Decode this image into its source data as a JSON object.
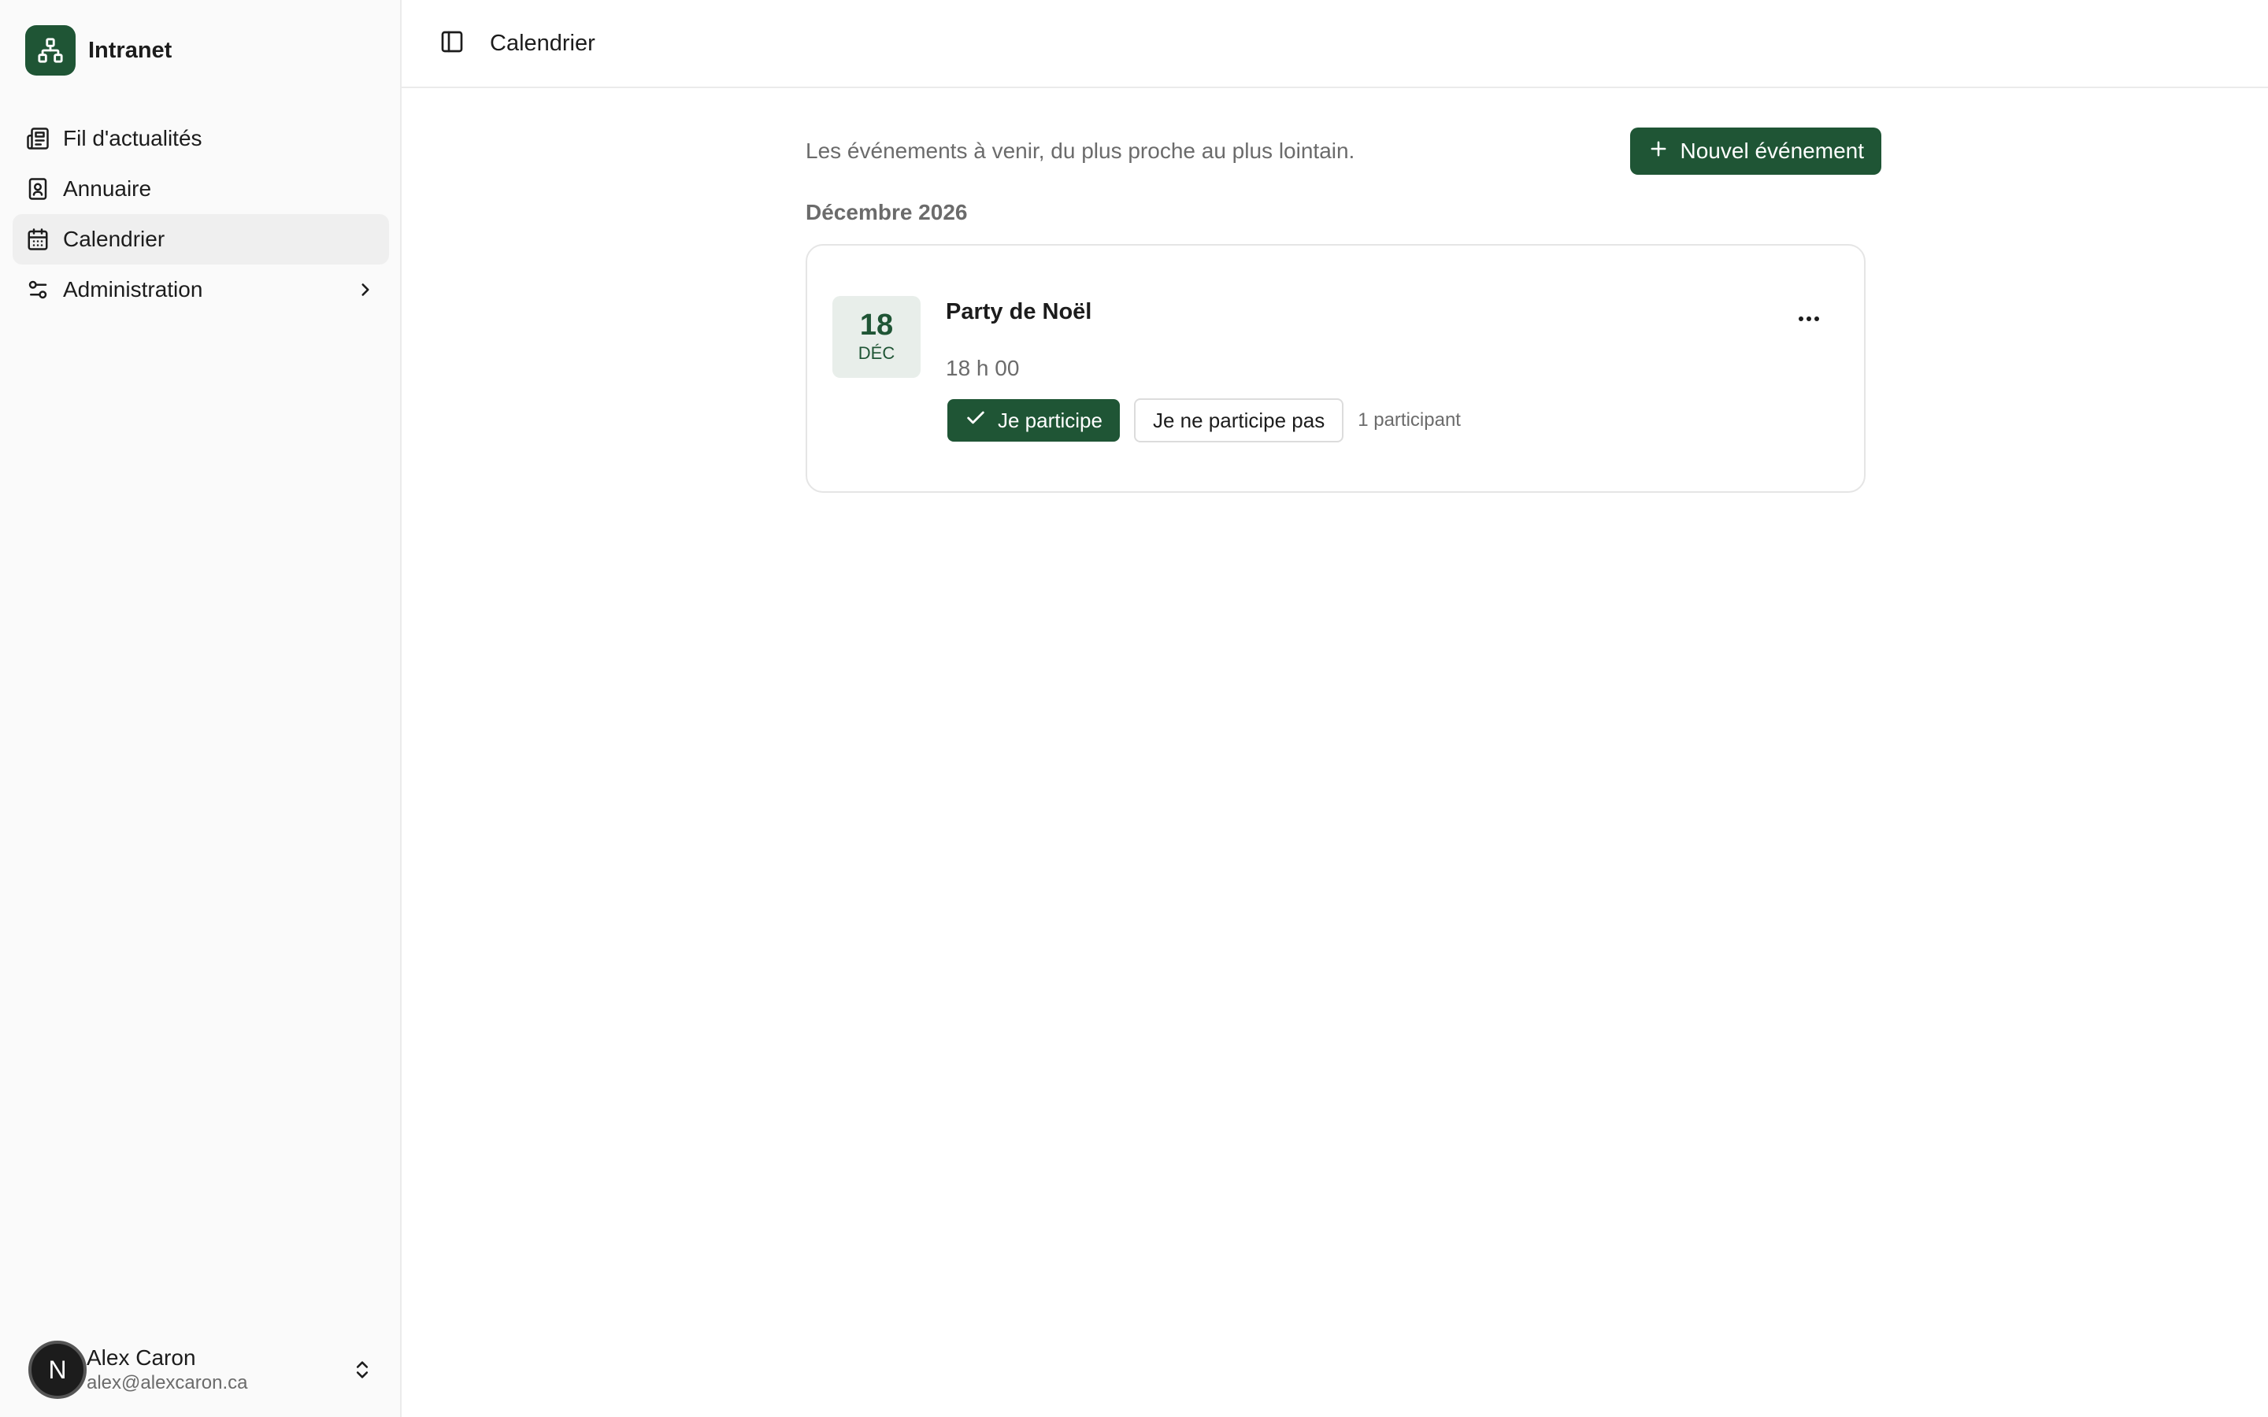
{
  "app": {
    "name": "Intranet"
  },
  "sidebar": {
    "items": [
      {
        "label": "Fil d'actualités",
        "icon": "newspaper-icon",
        "active": false
      },
      {
        "label": "Annuaire",
        "icon": "contact-book-icon",
        "active": false
      },
      {
        "label": "Calendrier",
        "icon": "calendar-icon",
        "active": true
      },
      {
        "label": "Administration",
        "icon": "settings-sliders-icon",
        "active": false,
        "has_submenu": true
      }
    ],
    "user": {
      "initial": "N",
      "name": "Alex Caron",
      "email": "alex@alexcaron.ca"
    }
  },
  "topbar": {
    "title": "Calendrier"
  },
  "main": {
    "subtitle": "Les événements à venir, du plus proche au plus lointain.",
    "new_event_label": "Nouvel événement",
    "groups": [
      {
        "month": "Décembre 2026",
        "events": [
          {
            "day": "18",
            "month_abbr": "DÉC",
            "title": "Party de Noël",
            "time": "18 h 00",
            "attend_label": "Je participe",
            "decline_label": "Je ne participe pas",
            "participants": "1 participant",
            "attending": true
          }
        ]
      }
    ]
  },
  "colors": {
    "accent": "#1f5535",
    "muted_text": "#6b6b6b",
    "badge_bg": "#e8eeea"
  }
}
